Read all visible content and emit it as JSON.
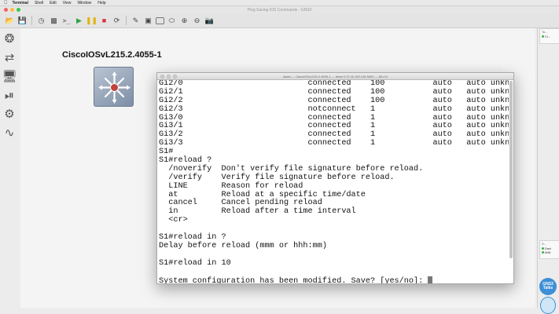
{
  "menubar": {
    "app_name": "Terminal",
    "items": [
      "Shell",
      "Edit",
      "View",
      "Window",
      "Help"
    ]
  },
  "gns_window": {
    "title": "Ping Saving IOS Commands - GNS3"
  },
  "toolbar": {
    "icons": [
      "folder-open-icon",
      "save-icon",
      "history-icon",
      "snapshot-icon",
      "console-icon",
      "start-all-icon",
      "suspend-all-icon",
      "stop-all-icon",
      "reload-all-icon",
      "note-icon",
      "image-icon",
      "rectangle-icon",
      "ellipse-icon",
      "zoom-in-icon",
      "zoom-out-icon",
      "screenshot-icon"
    ]
  },
  "workspace": {
    "node_label": "CiscoIOSvL215.2.4055-1"
  },
  "terminal": {
    "title": "david — CiscoIOSvL215.2.4055-1 — telnet 172.16.100.128 5000 — 80×24",
    "lines": [
      "Gi2/0                          connected    100          auto   auto unknown",
      "Gi2/1                          connected    100          auto   auto unknown",
      "Gi2/2                          connected    100          auto   auto unknown",
      "Gi2/3                          notconnect   1            auto   auto unknown",
      "Gi3/0                          connected    1            auto   auto unknown",
      "Gi3/1                          connected    1            auto   auto unknown",
      "Gi3/2                          connected    1            auto   auto unknown",
      "Gi3/3                          connected    1            auto   auto unknown",
      "S1#",
      "S1#reload ?",
      "  /noverify  Don't verify file signature before reload.",
      "  /verify    Verify file signature before reload.",
      "  LINE       Reason for reload",
      "  at         Reload at a specific time/date",
      "  cancel     Cancel pending reload",
      "  in         Reload after a time interval",
      "  <cr>",
      "",
      "S1#reload in ?",
      "Delay before reload (mmm or hhh:mm)",
      "",
      "S1#reload in 10",
      "",
      "System configuration has been modified. Save? [yes/no]: "
    ]
  },
  "right_dock": {
    "top_panel_title": "To...",
    "top_panel_item": "Ci...",
    "bottom_panel_title": "S...",
    "bottom_items": [
      "Davi",
      "IIMil"
    ],
    "badge_line1": "GNS3",
    "badge_line2": "Talks"
  },
  "colors": {
    "start": "#2ea043",
    "suspend": "#e0b400",
    "stop": "#d9333f",
    "badge": "#3d8fd6"
  }
}
